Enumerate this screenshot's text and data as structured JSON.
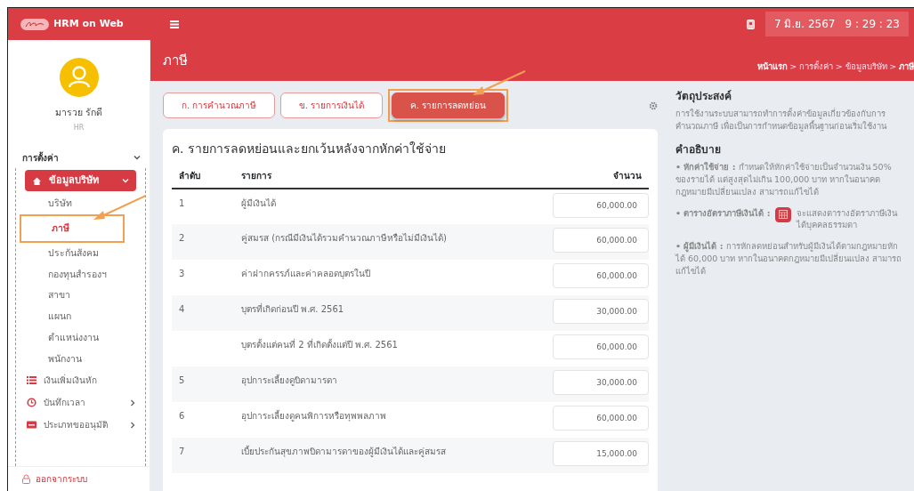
{
  "app": {
    "name": "HRM on Web",
    "date": "7 มิ.ย. 2567",
    "time": "9 : 29 : 23"
  },
  "sidebar": {
    "user": {
      "name": "มารวย รักดี",
      "role": "HR"
    },
    "section": {
      "label": "การตั้งค่า",
      "expanded": true
    },
    "groups": [
      {
        "label": "ข้อมูลบริษัท",
        "selected": true,
        "expanded": true,
        "children": [
          {
            "label": "บริษัท",
            "selected": false,
            "highlighted": false
          },
          {
            "label": "ภาษี",
            "selected": true,
            "highlighted": true
          },
          {
            "label": "ประกันสังคม",
            "selected": false,
            "highlighted": false
          },
          {
            "label": "กองทุนสำรองฯ",
            "selected": false,
            "highlighted": false
          },
          {
            "label": "สาขา",
            "selected": false,
            "highlighted": false
          },
          {
            "label": "แผนก",
            "selected": false,
            "highlighted": false
          },
          {
            "label": "ตำแหน่งงาน",
            "selected": false,
            "highlighted": false
          },
          {
            "label": "พนักงาน",
            "selected": false,
            "highlighted": false
          }
        ]
      },
      {
        "label": "เงินเพิ่มเงินหัก",
        "selected": false
      },
      {
        "label": "บันทึกเวลา",
        "selected": false,
        "expanded": false
      },
      {
        "label": "ประเภทขออนุมัติ",
        "selected": false,
        "expanded": false
      }
    ],
    "logout": "ออกจากระบบ"
  },
  "page": {
    "title": "ภาษี",
    "separator": ">",
    "breadcrumb": [
      {
        "label": "หน้าแรก",
        "bold": true
      },
      {
        "label": "การตั้งค่า",
        "bold": false
      },
      {
        "label": "ข้อมูลบริษัท",
        "bold": false
      },
      {
        "label": "ภาษี",
        "bold": true
      }
    ]
  },
  "tabs": [
    {
      "label": "ก. การคำนวณภาษี",
      "selected": false,
      "highlighted": false
    },
    {
      "label": "ข. รายการเงินได้",
      "selected": false,
      "highlighted": false
    },
    {
      "label": "ค. รายการลดหย่อน",
      "selected": true,
      "highlighted": true
    }
  ],
  "card": {
    "title": "ค. รายการลดหย่อนและยกเว้นหลังจากหักค่าใช้จ่าย",
    "columns": [
      "ลำดับ",
      "รายการ",
      "จำนวน"
    ],
    "rows": [
      {
        "no": "1",
        "item": "ผู้มีเงินได้",
        "amount": "60,000.00"
      },
      {
        "no": "2",
        "item": "คู่สมรส (กรณีมีเงินได้รวมคำนวณภาษีหรือไม่มีเงินได้)",
        "amount": "60,000.00"
      },
      {
        "no": "3",
        "item": "ค่าฝากครรภ์และค่าคลอดบุตรในปี",
        "amount": "60,000.00"
      },
      {
        "no": "4",
        "item": "บุตรที่เกิดก่อนปี พ.ศ. 2561",
        "amount": "30,000.00"
      },
      {
        "item": "บุตรตั้งแต่คนที่ 2 ที่เกิดตั้งแต่ปี พ.ศ. 2561",
        "amount": "60,000.00"
      },
      {
        "no": "5",
        "item": "อุปการะเลี้ยงดูบิดามารดา",
        "amount": "30,000.00"
      },
      {
        "no": "6",
        "item": "อุปการะเลี้ยงดูคนพิการหรือทุพพลภาพ",
        "amount": "60,000.00"
      },
      {
        "no": "7",
        "item": "เบี้ยประกันสุขภาพบิดามารดาของผู้มีเงินได้และคู่สมรส",
        "amount": "15,000.00"
      }
    ]
  },
  "info": {
    "purpose_title": "วัตถุประสงค์",
    "purpose": "การใช้งานระบบสามารถทำการตั้งค่าข้อมูลเกี่ยวข้องกับการคำนวณภาษี เพื่อเป็นการกำหนดข้อมูลพื้นฐานก่อนเริ่มใช้งาน",
    "notes_title": "คำอธิบาย",
    "notes": [
      {
        "kind": "plain",
        "term": "• หักค่าใช้จ่าย :",
        "text": "กำหนดให้หักค่าใช้จ่ายเป็นจำนวนเงิน 50% ของรายได้ แต่สูงสุดไม่เกิน 100,000 บาท หากในอนาคตกฎหมายมีเปลี่ยนแปลง สามารถแก้ไขได้"
      },
      {
        "kind": "button",
        "term": "• ตารางอัตราภาษีเงินได้ :",
        "text": "จะแสดงตารางอัตราภาษีเงินได้บุคคลธรรมดา"
      },
      {
        "kind": "plain",
        "term": "• ผู้มีเงินได้ :",
        "text": "การหักลดหย่อนสำหรับผู้มีเงินได้ตามกฎหมายหักได้ 60,000 บาท หากในอนาคตกฎหมายมีเปลี่ยนแปลง สามารถแก้ไขได้"
      }
    ]
  }
}
